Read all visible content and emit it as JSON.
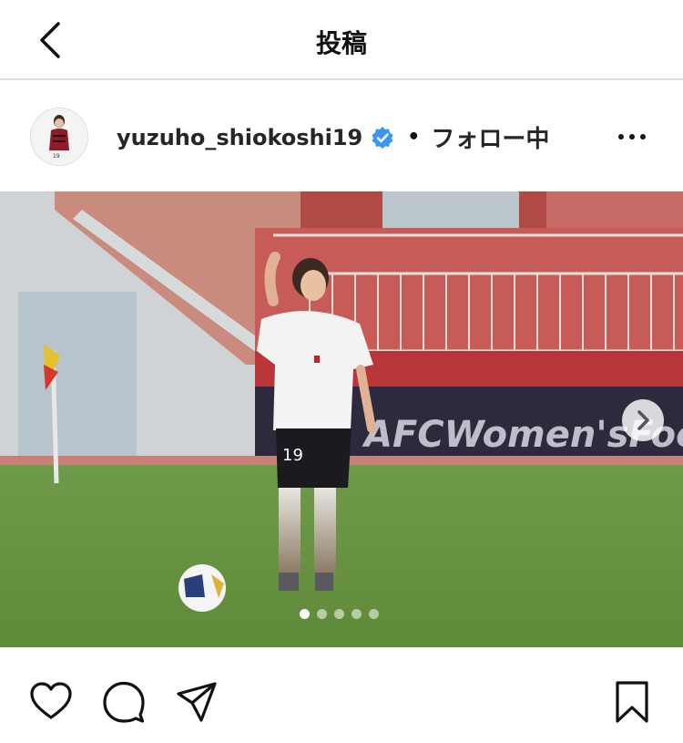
{
  "header": {
    "title": "投稿",
    "back_icon": "chevron-left-icon"
  },
  "post": {
    "username": "yuzuho_shiokoshi19",
    "verified": true,
    "separator": "•",
    "follow_status": "フォロー中",
    "more_icon": "more-horizontal-icon",
    "carousel": {
      "current_index": 1,
      "total": 5
    }
  },
  "photo": {
    "banner_text": "AFCWomen'sFootb",
    "jersey_number": "19"
  },
  "actions": {
    "like_icon": "heart-icon",
    "comment_icon": "comment-icon",
    "share_icon": "share-icon",
    "save_icon": "bookmark-icon"
  },
  "colors": {
    "verified": "#3897f0",
    "text": "#262626",
    "divider": "#dbdbdb"
  }
}
